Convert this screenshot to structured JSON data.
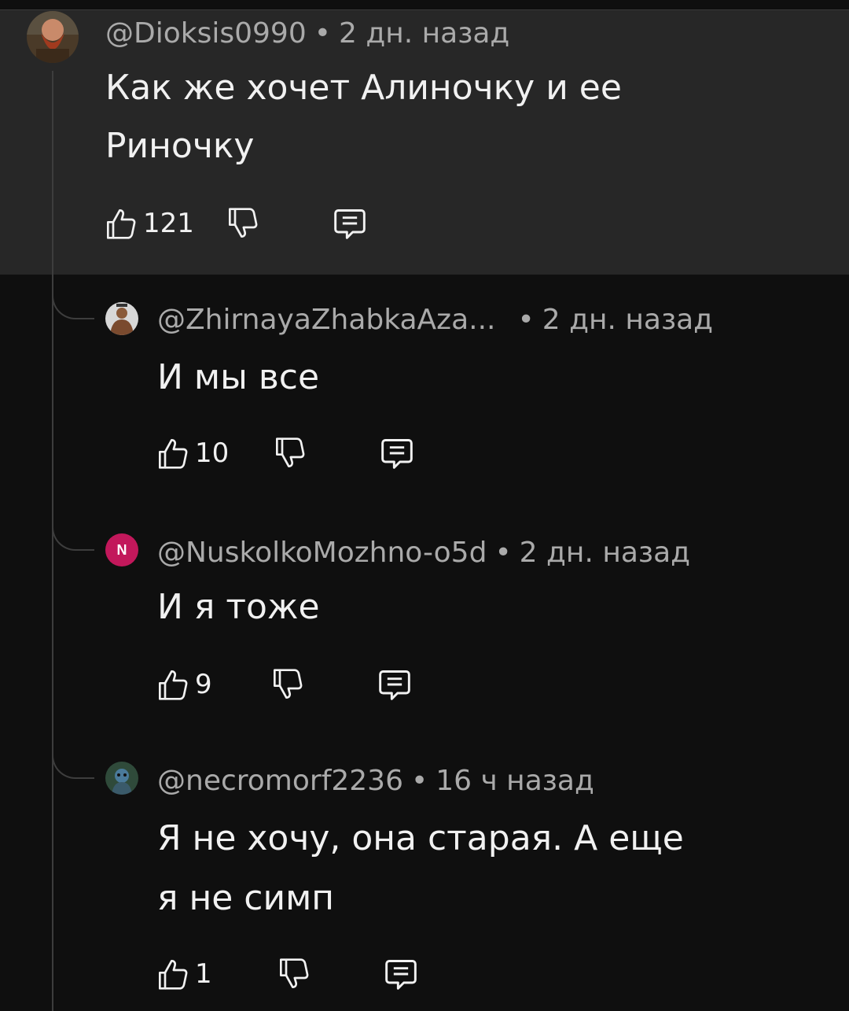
{
  "comments": [
    {
      "author": "@Dioksis0990",
      "time": "2 дн. назад",
      "text_line1": "Как же хочет Алиночку и ее",
      "text_line2": "Риночку",
      "likes": "121"
    },
    {
      "author": "@ZhirnayaZhabkaAza...",
      "time": "2 дн. назад",
      "text_line1": "И мы все",
      "likes": "10"
    },
    {
      "author": "@NuskolkoMozhno-o5d",
      "avatar_letter": "N",
      "time": "2 дн. назад",
      "text_line1": "И я тоже",
      "likes": "9"
    },
    {
      "author": "@necromorf2236",
      "time": "16 ч назад",
      "text_line1": "Я не хочу, она старая. А еще",
      "text_line2": "я не симп",
      "likes": "1"
    }
  ],
  "meta_separator": "•",
  "colors": {
    "background": "#0f0f0f",
    "highlight": "#272727",
    "text": "#f1f1f1",
    "meta": "#aaaaaa",
    "avatar_n": "#c2185b"
  },
  "icons": [
    "thumb-up-icon",
    "thumb-down-icon",
    "reply-icon"
  ]
}
